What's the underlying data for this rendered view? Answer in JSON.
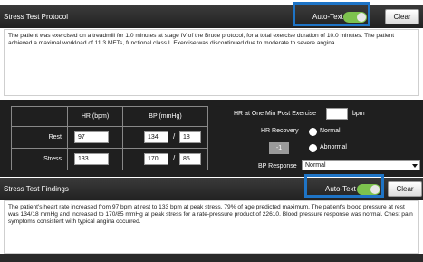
{
  "protocol_panel": {
    "title": "Stress Test Protocol",
    "autotext_label": "Auto-Text",
    "clear_label": "Clear",
    "text": "The patient was exercised on a treadmill for 1.0 minutes at stage IV of the Bruce protocol, for a total exercise duration of 10.0 minutes. The patient achieved a maximal workload of 11.3 METs, functional class I. Exercise was discontinued due to moderate to severe angina."
  },
  "vitals": {
    "columns": [
      "HR (bpm)",
      "BP (mmHg)"
    ],
    "rows": [
      {
        "label": "Rest",
        "hr": "97",
        "bp_sys": "134",
        "bp_dia": "18"
      },
      {
        "label": "Stress",
        "hr": "133",
        "bp_sys": "170",
        "bp_dia": "85"
      }
    ],
    "slash": "/",
    "hr_one_min_label": "HR at One Min Post Exercise",
    "hr_one_min_value": "",
    "hr_one_min_unit": "bpm",
    "hr_recovery_label": "HR Recovery",
    "hr_recovery_value": "-1",
    "option_normal": "Normal",
    "option_abnormal": "Abnormal",
    "bp_response_label": "BP Response",
    "bp_response_value": "Normal"
  },
  "findings_panel": {
    "title": "Stress Test Findings",
    "autotext_label": "Auto-Text",
    "clear_label": "Clear",
    "text": "The patient's heart rate increased from 97 bpm at rest to 133 bpm at peak stress, 79% of age predicted maximum. The patient's blood pressure at rest was 134/18 mmHg and increased to 170/85 mmHg at peak stress for a rate-pressure product of 22610. Blood pressure response was normal. Chest pain symptoms consistent with typical angina occurred."
  },
  "colors": {
    "header_bg": "#2a2a2a",
    "highlight": "#1e74c6",
    "toggle_on": "#7dc24e",
    "vitals_bg": "#1f1f1f"
  }
}
